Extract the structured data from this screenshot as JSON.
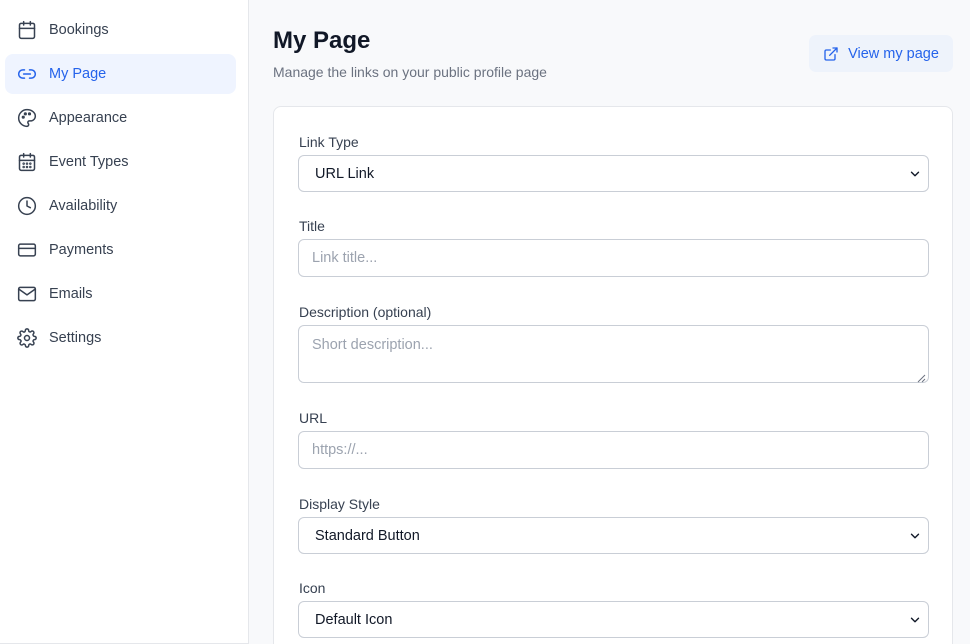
{
  "sidebar": {
    "items": [
      {
        "label": "Bookings",
        "icon": "calendar-icon",
        "active": false
      },
      {
        "label": "My Page",
        "icon": "link-icon",
        "active": true
      },
      {
        "label": "Appearance",
        "icon": "palette-icon",
        "active": false
      },
      {
        "label": "Event Types",
        "icon": "calendar-grid-icon",
        "active": false
      },
      {
        "label": "Availability",
        "icon": "clock-icon",
        "active": false
      },
      {
        "label": "Payments",
        "icon": "credit-card-icon",
        "active": false
      },
      {
        "label": "Emails",
        "icon": "mail-icon",
        "active": false
      },
      {
        "label": "Settings",
        "icon": "gear-icon",
        "active": false
      }
    ]
  },
  "header": {
    "title": "My Page",
    "subtitle": "Manage the links on your public profile page",
    "view_button_label": "View my page",
    "view_button_icon": "external-link-icon"
  },
  "form": {
    "link_type": {
      "label": "Link Type",
      "value": "URL Link"
    },
    "title": {
      "label": "Title",
      "placeholder": "Link title..."
    },
    "description": {
      "label": "Description (optional)",
      "placeholder": "Short description..."
    },
    "url": {
      "label": "URL",
      "placeholder": "https://..."
    },
    "display_style": {
      "label": "Display Style",
      "value": "Standard Button"
    },
    "icon": {
      "label": "Icon",
      "value": "Default Icon"
    }
  },
  "colors": {
    "accent": "#2563eb",
    "active_bg": "#eff4ff",
    "page_bg": "#f8f9fb"
  }
}
